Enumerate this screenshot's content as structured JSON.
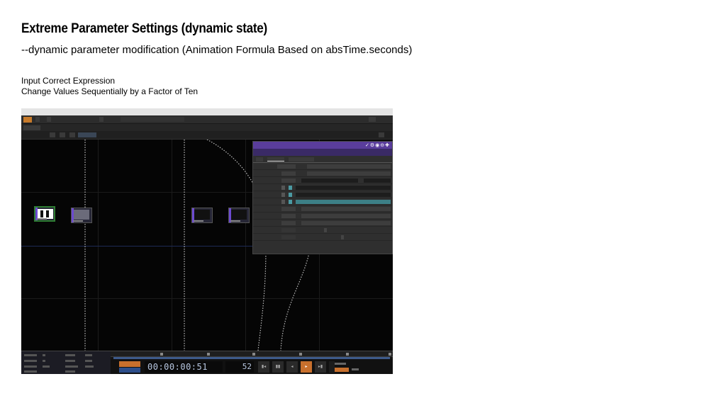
{
  "slide": {
    "title": "Extreme Parameter Settings (dynamic state)",
    "subtitle": "--dynamic parameter modification (Animation Formula Based on absTime.seconds)",
    "notes": [
      "Input Correct Expression",
      "Change Values Sequentially by a Factor of Ten"
    ]
  },
  "app": {
    "timecode": "00:00:00:51",
    "frame": "52",
    "colors": {
      "panel_header": "#5a3d9c",
      "accent_orange": "#c8702d",
      "expression_field": "#3c7f86",
      "selected_node_border": "#2e7d32"
    }
  }
}
